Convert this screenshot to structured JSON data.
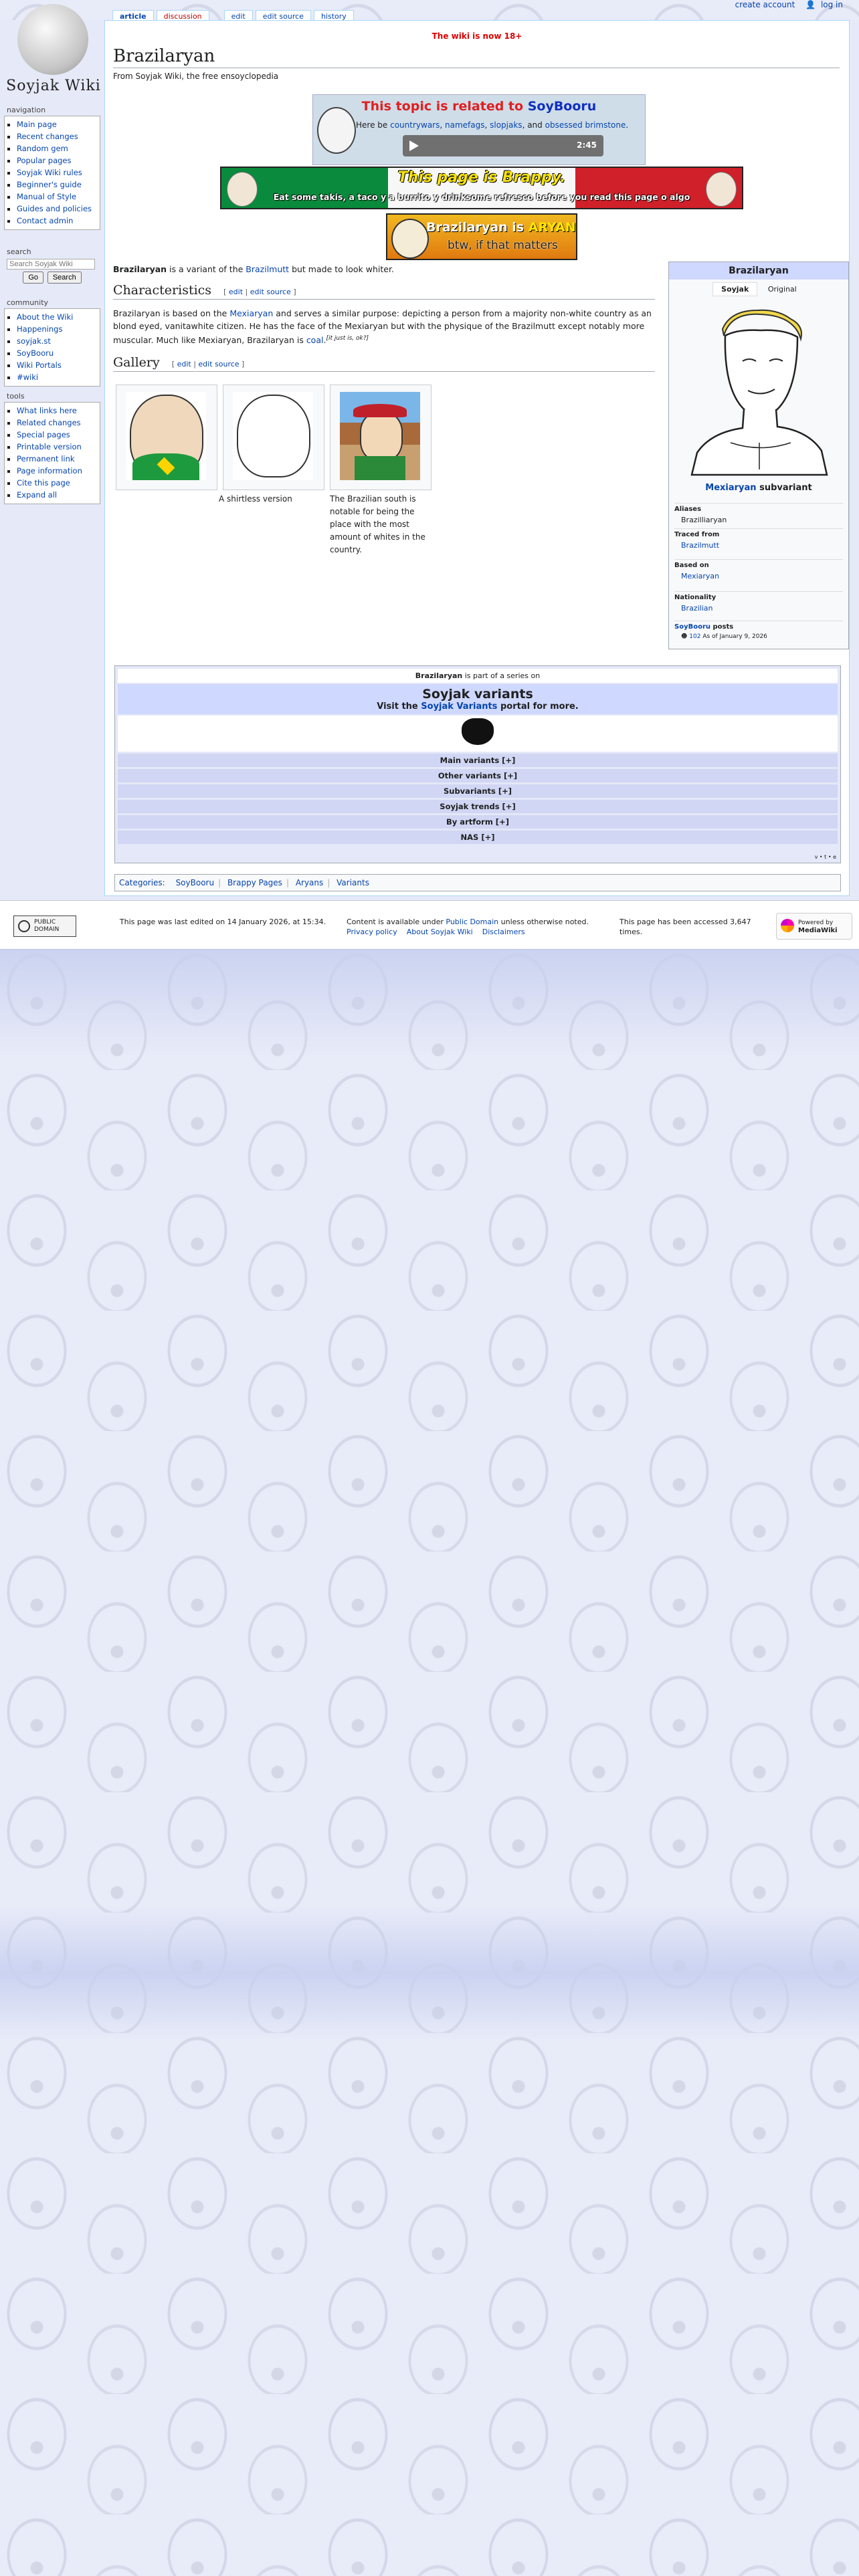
{
  "personal": {
    "create_account": "create account",
    "log_in": "log in"
  },
  "tabs": {
    "article": "article",
    "discussion": "discussion",
    "edit": "edit",
    "edit_source": "edit source",
    "history": "history"
  },
  "site": {
    "wordmark": "Soyjak Wiki"
  },
  "sidebar": {
    "navigation": {
      "title": "navigation",
      "items": [
        "Main page",
        "Recent changes",
        "Random gem",
        "Popular pages",
        "Soyjak Wiki rules",
        "Beginner's guide",
        "Manual of Style",
        "Guides and policies",
        "Contact admin"
      ]
    },
    "search": {
      "title": "search",
      "placeholder": "Search Soyjak Wiki",
      "go": "Go",
      "search": "Search"
    },
    "community": {
      "title": "community",
      "items": [
        "About the Wiki",
        "Happenings",
        "soyjak.st",
        "SoyBooru",
        "Wiki Portals",
        "#wiki"
      ]
    },
    "tools": {
      "title": "tools",
      "items": [
        "What links here",
        "Related changes",
        "Special pages",
        "Printable version",
        "Permanent link",
        "Page information",
        "Cite this page",
        "Expand all"
      ]
    }
  },
  "notice": "The wiki is now 18+",
  "page": {
    "title": "Brazilaryan",
    "tagline": "From Soyjak Wiki, the free ensoyclopedia"
  },
  "soybox": {
    "title_a": "This topic is related to",
    "title_link": "SoyBooru",
    "sub_a": "Here be",
    "l1": "countrywars",
    "l2": "namefags",
    "l3": "slopjaks",
    "sub_b": ", and",
    "l4": "obsessed brimstone",
    "sub_c": ".",
    "duration": "2:45"
  },
  "brappy": {
    "title": "This page is Brappy.",
    "sub": "Eat some takis, a taco y a burrito y drinksome refresco before you read this page o algo"
  },
  "aryan": {
    "title_a": "Brazilaryan is",
    "title_b": "ARYAN",
    "sub": "btw, if that matters"
  },
  "intro": {
    "bold": "Brazilaryan",
    "a": "is a variant of the",
    "link": "Brazilmutt",
    "b": "but made to look whiter."
  },
  "characteristics": {
    "heading": "Characteristics",
    "edit": "edit",
    "edit_source": "edit source",
    "p_a": "Brazilaryan is based on the",
    "p_link": "Mexiaryan",
    "p_b": "and serves a similar purpose: depicting a person from a majority non-white country as an blond eyed, vanitawhite citizen. He has the face of the Mexiaryan but with the physique of the Brazilmutt except notably more muscular. Much like Mexiaryan, Brazilaryan is",
    "p_coal": "coal",
    "p_sup": "[it just is, ok?]"
  },
  "gallery": {
    "heading": "Gallery",
    "edit": "edit",
    "edit_source": "edit source",
    "captions": [
      "",
      "A shirtless version",
      "The Brazilian south is notable for being the place with the most amount of whites in the country."
    ]
  },
  "infobox": {
    "title": "Brazilaryan",
    "tab_soyjak": "Soyjak",
    "tab_original": "Original",
    "caption_link": "Mexiaryan",
    "caption_rest": "subvariant",
    "aliases_label": "Aliases",
    "aliases": "Brazilliaryan",
    "traced_label": "Traced from",
    "traced": "Brazilmutt",
    "based_label": "Based on",
    "based": "Mexiaryan",
    "nationality_label": "Nationality",
    "nationality": "Brazilian",
    "posts_link": "SoyBooru",
    "posts_label": "posts",
    "posts_count": "102",
    "posts_date": "As of January 9, 2026"
  },
  "navbox": {
    "top_bold": "Brazilaryan",
    "top_rest": "is part of a series on",
    "title": "Soyjak variants",
    "visit_a": "Visit the",
    "visit_link": "Soyjak Variants",
    "visit_b": "portal for more.",
    "groups": [
      "Main variants [+]",
      "Other variants [+]",
      "Subvariants [+]",
      "Soyjak trends [+]",
      "By artform [+]",
      "NAS [+]"
    ],
    "vte": "v • t • e"
  },
  "categories": {
    "label": "Categories:",
    "items": [
      "SoyBooru",
      "Brappy Pages",
      "Aryans",
      "Variants"
    ]
  },
  "footer": {
    "pd_a": "PUBLIC",
    "pd_b": "DOMAIN",
    "last_edited": "This page was last edited on 14 January 2026, at 15:34.",
    "content_a": "Content is available under",
    "content_link": "Public Domain",
    "content_b": "unless otherwise noted.",
    "privacy": "Privacy policy",
    "about": "About Soyjak Wiki",
    "disclaimers": "Disclaimers",
    "accessed_a": "This page has been accessed 3,647",
    "accessed_b": "times.",
    "mw_a": "Powered by",
    "mw_b": "MediaWiki"
  },
  "colors": {
    "link": "#0645ad",
    "notice": "#dd0000",
    "header_blue": "#cfd8ff",
    "background": "#e6e9f7"
  }
}
